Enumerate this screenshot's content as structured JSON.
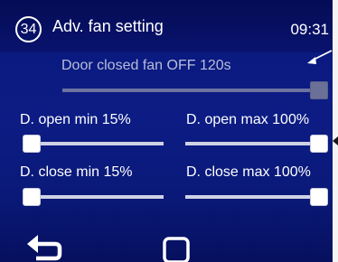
{
  "header": {
    "page_number": "34",
    "title": "Adv. fan setting",
    "time": "09:31"
  },
  "door_closed_fan": {
    "label": "Door closed fan OFF  120s",
    "enabled": false,
    "value_fraction": 1.0
  },
  "sliders": {
    "door_open_min": {
      "label": "D. open min 15%",
      "value_fraction": 0.0
    },
    "door_open_max": {
      "label": "D. open max 100%",
      "value_fraction": 1.0
    },
    "door_close_min": {
      "label": "D. close min 15%",
      "value_fraction": 0.0
    },
    "door_close_max": {
      "label": "D. close max 100%",
      "value_fraction": 1.0
    }
  },
  "footer": {
    "back_icon": "return-arrow-icon",
    "home_icon": "square-home-icon"
  },
  "colors": {
    "background": "#0c1c84",
    "header": "#050c55",
    "text": "#ffffff",
    "disabled_text": "#b9bdd9"
  }
}
